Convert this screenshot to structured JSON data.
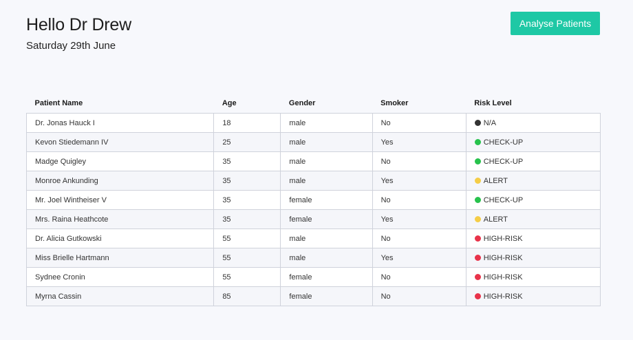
{
  "header": {
    "greeting": "Hello Dr Drew",
    "date": "Saturday 29th June",
    "analyse_button": "Analyse Patients"
  },
  "colors": {
    "accent": "#1ec8a5",
    "risk_na": "#333333",
    "risk_checkup": "#27c24c",
    "risk_alert": "#f5cd47",
    "risk_high": "#e8334a"
  },
  "table": {
    "headers": [
      "Patient Name",
      "Age",
      "Gender",
      "Smoker",
      "Risk Level"
    ],
    "rows": [
      {
        "name": "Dr. Jonas Hauck I",
        "age": "18",
        "gender": "male",
        "smoker": "No",
        "risk": "N/A",
        "risk_color": "#333333"
      },
      {
        "name": "Kevon Stiedemann IV",
        "age": "25",
        "gender": "male",
        "smoker": "Yes",
        "risk": "CHECK-UP",
        "risk_color": "#27c24c"
      },
      {
        "name": "Madge Quigley",
        "age": "35",
        "gender": "male",
        "smoker": "No",
        "risk": "CHECK-UP",
        "risk_color": "#27c24c"
      },
      {
        "name": "Monroe Ankunding",
        "age": "35",
        "gender": "male",
        "smoker": "Yes",
        "risk": "ALERT",
        "risk_color": "#f5cd47"
      },
      {
        "name": "Mr. Joel Wintheiser V",
        "age": "35",
        "gender": "female",
        "smoker": "No",
        "risk": "CHECK-UP",
        "risk_color": "#27c24c"
      },
      {
        "name": "Mrs. Raina Heathcote",
        "age": "35",
        "gender": "female",
        "smoker": "Yes",
        "risk": "ALERT",
        "risk_color": "#f5cd47"
      },
      {
        "name": "Dr. Alicia Gutkowski",
        "age": "55",
        "gender": "male",
        "smoker": "No",
        "risk": "HIGH-RISK",
        "risk_color": "#e8334a"
      },
      {
        "name": "Miss Brielle Hartmann",
        "age": "55",
        "gender": "male",
        "smoker": "Yes",
        "risk": "HIGH-RISK",
        "risk_color": "#e8334a"
      },
      {
        "name": "Sydnee Cronin",
        "age": "55",
        "gender": "female",
        "smoker": "No",
        "risk": "HIGH-RISK",
        "risk_color": "#e8334a"
      },
      {
        "name": "Myrna Cassin",
        "age": "85",
        "gender": "female",
        "smoker": "No",
        "risk": "HIGH-RISK",
        "risk_color": "#e8334a"
      }
    ]
  }
}
